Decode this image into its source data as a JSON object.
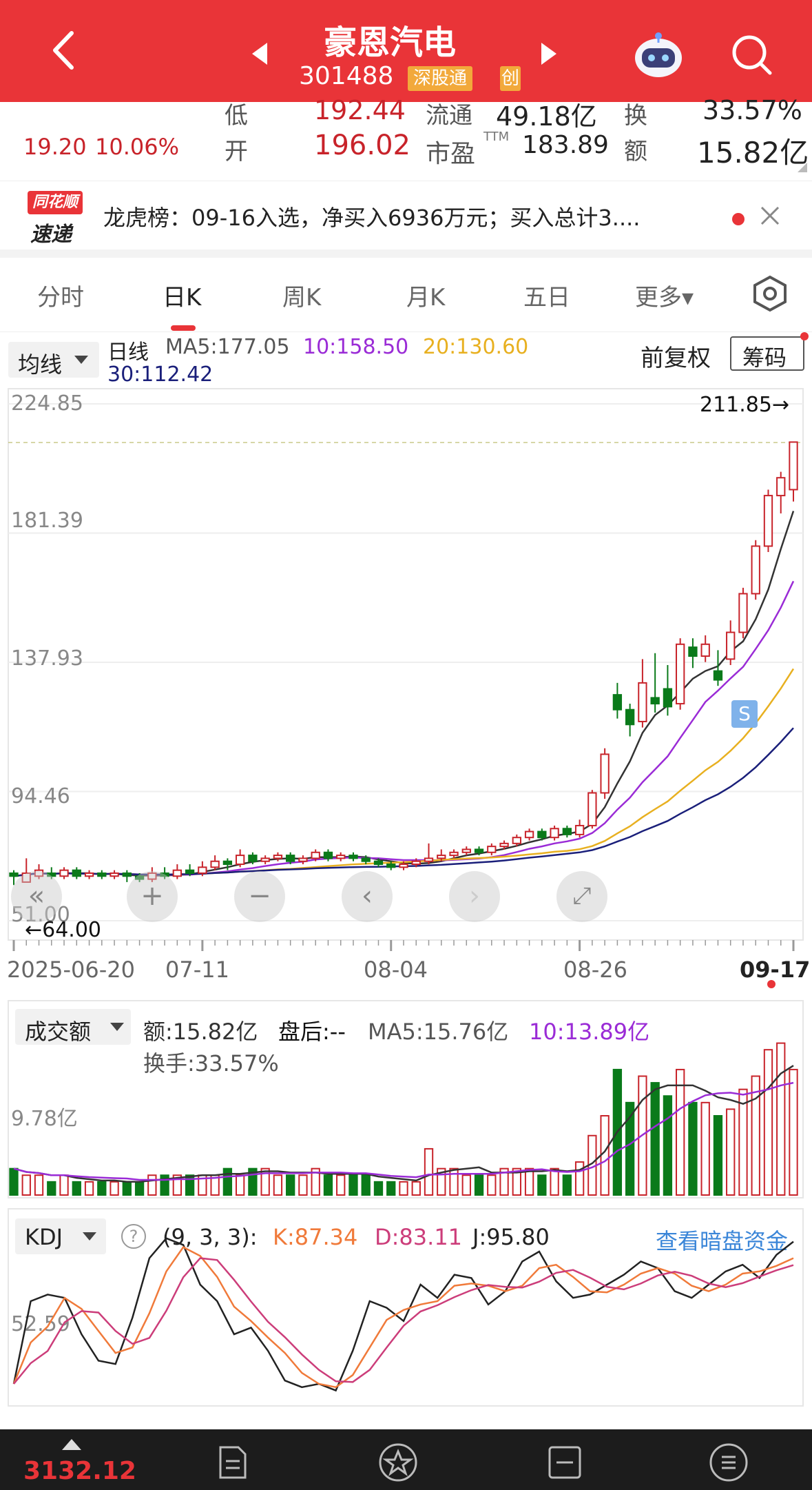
{
  "header": {
    "stock_name": "豪恩汽电",
    "stock_code": "301488",
    "badge_connect": "深股通",
    "badge_board": "创"
  },
  "quote": {
    "low_label": "低",
    "low_value": "192.44",
    "float_label": "流通",
    "float_value": "49.18亿",
    "turnover_label": "换",
    "turnover_value": "33.57%",
    "change": "19.20",
    "change_pct": "10.06%",
    "open_label": "开",
    "open_value": "196.02",
    "pe_label": "市盈",
    "pe_sup": "TTM",
    "pe_value": "183.89",
    "amount_label": "额",
    "amount_value": "15.82亿"
  },
  "news": {
    "logo_top": "同花顺",
    "logo_bottom": "速递",
    "text": "龙虎榜：09-16入选，净买入6936万元；买入总计3...."
  },
  "tabs": [
    "分时",
    "日K",
    "周K",
    "月K",
    "五日",
    "更多▾"
  ],
  "kline": {
    "ma_dropdown": "均线",
    "period": "日线",
    "ma5": "MA5:177.05",
    "ma10": "10:158.50",
    "ma20": "20:130.60",
    "ma30": "30:112.42",
    "adjust": "前复权",
    "chip_button": "筹码",
    "y_ticks": [
      "224.85",
      "181.39",
      "137.93",
      "94.46",
      "51.00"
    ],
    "high_marker": "211.85→",
    "low_marker": "←64.00",
    "x_ticks": [
      "2025-06-20",
      "07-11",
      "08-04",
      "08-26",
      "09-17"
    ],
    "signal": "S"
  },
  "volume": {
    "dropdown": "成交额",
    "amount": "额:15.82亿",
    "after_hours": "盘后:--",
    "ma5": "MA5:15.76亿",
    "ma10": "10:13.89亿",
    "turnover": "换手:33.57%",
    "y_tick": "9.78亿"
  },
  "kdj": {
    "dropdown": "KDJ",
    "params": "(9, 3, 3):",
    "k": "K:87.34",
    "d": "D:83.11",
    "j": "J:95.80",
    "link": "查看暗盘资金",
    "y_tick": "52.59"
  },
  "footer": {
    "index_value": "3132.12"
  },
  "colors": {
    "brand_red": "#e93438",
    "up": "#c8232a",
    "down": "#0a7a1a",
    "ma5": "#333333",
    "ma10": "#9a2bd6",
    "ma20": "#e8b020",
    "ma30": "#1a1f7a",
    "k": "#f07a3a",
    "d": "#cc3d7a",
    "j": "#222222"
  },
  "chart_data": {
    "type": "candlestick",
    "title": "",
    "x_ticks": [
      "2025-06-20",
      "07-11",
      "08-04",
      "08-26",
      "09-17"
    ],
    "ylim": [
      51.0,
      224.85
    ],
    "y_ticks": [
      224.85,
      181.39,
      137.93,
      94.46,
      51.0
    ],
    "candles": [
      {
        "o": 67,
        "c": 66,
        "h": 68,
        "l": 63
      },
      {
        "o": 64,
        "c": 67,
        "h": 72,
        "l": 64
      },
      {
        "o": 66,
        "c": 68,
        "h": 70,
        "l": 65
      },
      {
        "o": 67,
        "c": 66,
        "h": 69,
        "l": 65
      },
      {
        "o": 66,
        "c": 68,
        "h": 69,
        "l": 65
      },
      {
        "o": 68,
        "c": 66,
        "h": 69,
        "l": 65
      },
      {
        "o": 66,
        "c": 67,
        "h": 68,
        "l": 65
      },
      {
        "o": 67,
        "c": 66,
        "h": 68,
        "l": 65
      },
      {
        "o": 66,
        "c": 67,
        "h": 68,
        "l": 65
      },
      {
        "o": 67,
        "c": 66,
        "h": 68,
        "l": 64
      },
      {
        "o": 66,
        "c": 65,
        "h": 67,
        "l": 64
      },
      {
        "o": 65,
        "c": 67,
        "h": 69,
        "l": 64
      },
      {
        "o": 67,
        "c": 66,
        "h": 69,
        "l": 65
      },
      {
        "o": 66,
        "c": 68,
        "h": 70,
        "l": 65
      },
      {
        "o": 68,
        "c": 67,
        "h": 70,
        "l": 66
      },
      {
        "o": 67,
        "c": 69,
        "h": 71,
        "l": 66
      },
      {
        "o": 69,
        "c": 71,
        "h": 73,
        "l": 68
      },
      {
        "o": 71,
        "c": 70,
        "h": 72,
        "l": 68
      },
      {
        "o": 70,
        "c": 73,
        "h": 75,
        "l": 69
      },
      {
        "o": 73,
        "c": 71,
        "h": 74,
        "l": 70
      },
      {
        "o": 71,
        "c": 72,
        "h": 73,
        "l": 70
      },
      {
        "o": 72,
        "c": 73,
        "h": 74,
        "l": 71
      },
      {
        "o": 73,
        "c": 71,
        "h": 74,
        "l": 70
      },
      {
        "o": 71,
        "c": 72,
        "h": 73,
        "l": 70
      },
      {
        "o": 72,
        "c": 74,
        "h": 75,
        "l": 71
      },
      {
        "o": 74,
        "c": 72,
        "h": 75,
        "l": 71
      },
      {
        "o": 72,
        "c": 73,
        "h": 74,
        "l": 71
      },
      {
        "o": 73,
        "c": 72,
        "h": 74,
        "l": 71
      },
      {
        "o": 72,
        "c": 71,
        "h": 73,
        "l": 70
      },
      {
        "o": 71,
        "c": 70,
        "h": 72,
        "l": 69
      },
      {
        "o": 70,
        "c": 69,
        "h": 71,
        "l": 68
      },
      {
        "o": 69,
        "c": 70,
        "h": 71,
        "l": 68
      },
      {
        "o": 70,
        "c": 71,
        "h": 72,
        "l": 69
      },
      {
        "o": 71,
        "c": 72,
        "h": 77,
        "l": 70
      },
      {
        "o": 72,
        "c": 73,
        "h": 75,
        "l": 71
      },
      {
        "o": 73,
        "c": 74,
        "h": 75,
        "l": 72
      },
      {
        "o": 74,
        "c": 75,
        "h": 76,
        "l": 73
      },
      {
        "o": 75,
        "c": 74,
        "h": 76,
        "l": 73
      },
      {
        "o": 74,
        "c": 76,
        "h": 77,
        "l": 73
      },
      {
        "o": 76,
        "c": 77,
        "h": 78,
        "l": 75
      },
      {
        "o": 77,
        "c": 79,
        "h": 80,
        "l": 76
      },
      {
        "o": 79,
        "c": 81,
        "h": 82,
        "l": 78
      },
      {
        "o": 81,
        "c": 79,
        "h": 82,
        "l": 78
      },
      {
        "o": 79,
        "c": 82,
        "h": 83,
        "l": 78
      },
      {
        "o": 82,
        "c": 80,
        "h": 83,
        "l": 79
      },
      {
        "o": 80,
        "c": 83,
        "h": 85,
        "l": 79
      },
      {
        "o": 83,
        "c": 94,
        "h": 95,
        "l": 82
      },
      {
        "o": 94,
        "c": 107,
        "h": 109,
        "l": 92
      },
      {
        "o": 127,
        "c": 122,
        "h": 131,
        "l": 119
      },
      {
        "o": 122,
        "c": 117,
        "h": 124,
        "l": 113
      },
      {
        "o": 118,
        "c": 131,
        "h": 139,
        "l": 116
      },
      {
        "o": 126,
        "c": 124,
        "h": 141,
        "l": 121
      },
      {
        "o": 129,
        "c": 123,
        "h": 137,
        "l": 120
      },
      {
        "o": 124,
        "c": 144,
        "h": 146,
        "l": 122
      },
      {
        "o": 143,
        "c": 140,
        "h": 146,
        "l": 136
      },
      {
        "o": 140,
        "c": 144,
        "h": 147,
        "l": 138
      },
      {
        "o": 135,
        "c": 132,
        "h": 142,
        "l": 130
      },
      {
        "o": 139,
        "c": 148,
        "h": 152,
        "l": 137
      },
      {
        "o": 148,
        "c": 161,
        "h": 163,
        "l": 146
      },
      {
        "o": 161,
        "c": 177,
        "h": 179,
        "l": 159
      },
      {
        "o": 177,
        "c": 194,
        "h": 196,
        "l": 175
      },
      {
        "o": 194,
        "c": 200,
        "h": 202,
        "l": 188
      },
      {
        "o": 196,
        "c": 212,
        "h": 212,
        "l": 192
      }
    ],
    "volume_ylabel_tick": "9.78亿",
    "kdj": {
      "k": 87.34,
      "d": 83.11,
      "j": 95.8
    }
  }
}
